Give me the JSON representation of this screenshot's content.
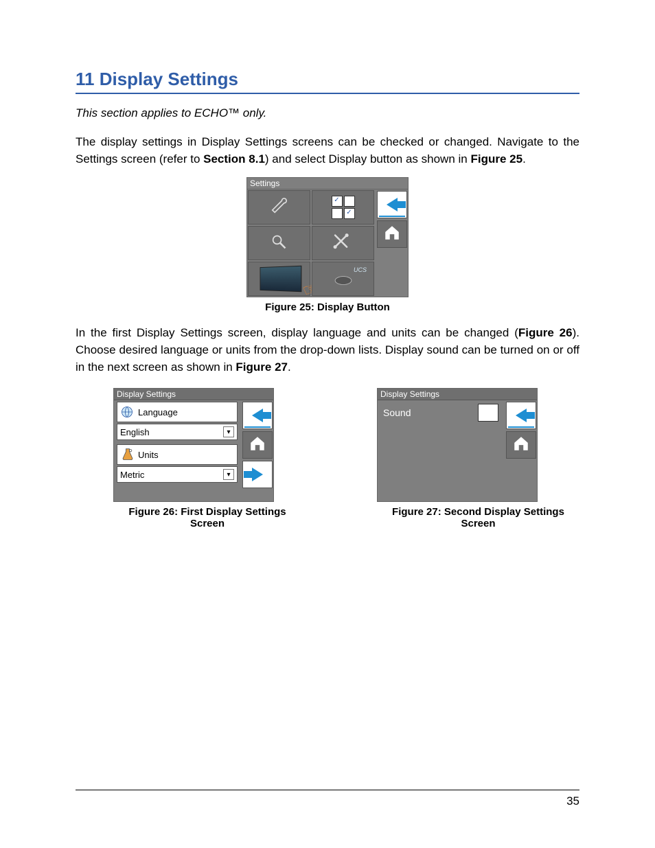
{
  "heading": "11  Display Settings",
  "note": "This section applies to ECHO™ only.",
  "para1_a": "The display settings in Display Settings screens can be checked or changed. Navigate to the Settings screen (refer to ",
  "para1_bold1": "Section 8.1",
  "para1_b": ") and select Display button as shown in ",
  "para1_bold2": "Figure 25",
  "para1_c": ".",
  "fig25": {
    "title": "Settings",
    "caption": "Figure 25: Display Button",
    "ucs": "UCS"
  },
  "para2_a": "In the first Display Settings screen, display language and units can be changed (",
  "para2_bold1": "Figure 26",
  "para2_b": "). Choose desired language or units from the drop-down lists. Display sound can be turned on or off in the next screen as shown in ",
  "para2_bold2": "Figure 27",
  "para2_c": ".",
  "fig26": {
    "title": "Display Settings",
    "language_label": "Language",
    "language_value": "English",
    "units_label": "Units",
    "units_value": "Metric",
    "caption": "Figure 26: First Display Settings Screen"
  },
  "fig27": {
    "title": "Display Settings",
    "sound_label": "Sound",
    "sound_checked": "✓",
    "caption": "Figure 27: Second Display Settings Screen"
  },
  "page_number": "35"
}
